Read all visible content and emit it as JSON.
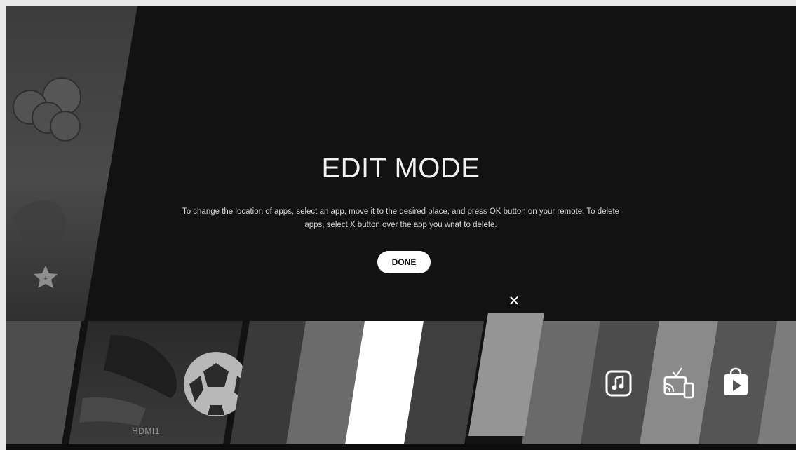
{
  "overlay": {
    "title": "EDIT MODE",
    "description": "To change the location of apps, select an app, move it to the desired place, and press OK button on your remote. To delete apps, select X button over the app you wnat to delete.",
    "done_label": "DONE",
    "close_icon": "close-icon"
  },
  "launcher": {
    "input_label": "HDMI1",
    "app_icons": [
      "music-icon",
      "screen-share-icon",
      "app-store-icon"
    ]
  },
  "colors": {
    "background": "#121212",
    "text": "#f2f2f2",
    "button_bg": "#ffffff",
    "button_text": "#111111"
  }
}
